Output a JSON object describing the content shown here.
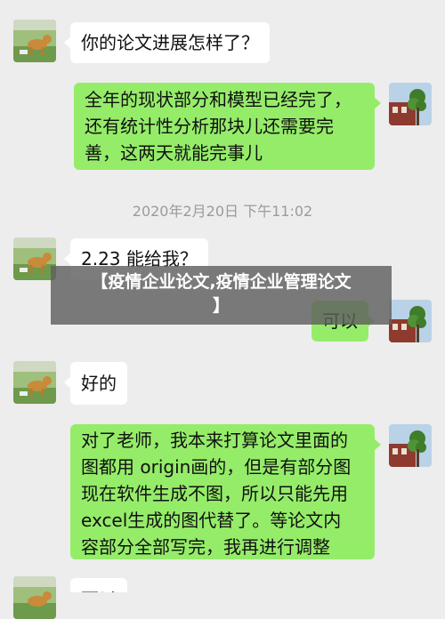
{
  "messages": [
    {
      "sender": "teacher",
      "lines": [
        "你的论文进展怎样了？"
      ]
    },
    {
      "sender": "student",
      "lines": [
        "全年的现状部分和模型已经完了，",
        "还有统计性分析那块儿还需要完",
        "善，这两天就能完事儿"
      ]
    },
    {
      "sender": "teacher",
      "lines": [
        "2.23 能给我？"
      ]
    },
    {
      "sender": "student",
      "lines": [
        "可以"
      ]
    },
    {
      "sender": "teacher",
      "lines": [
        "好的"
      ]
    },
    {
      "sender": "student",
      "lines": [
        "对了老师，我本来打算论文里面的",
        "图都用 origin画的，但是有部分图",
        "现在软件生成不图，所以只能先用",
        "excel生成的图代替了。等论文内",
        "容部分全部写完，我再进行调整"
      ]
    },
    {
      "sender": "teacher",
      "lines": [
        "可以"
      ]
    }
  ],
  "timestamp": "2020年2月20日 下午11:02",
  "banner": {
    "line1": "【疫情企业论文,疫情企业管理论文",
    "line2": "】"
  },
  "colors": {
    "background": "#ededed",
    "incoming_bubble": "#ffffff",
    "outgoing_bubble": "#95ec69",
    "timestamp_text": "#9b9b9b"
  },
  "icons": {
    "teacher_avatar": "dog-avatar-icon",
    "student_avatar": "tree-house-avatar-icon"
  }
}
